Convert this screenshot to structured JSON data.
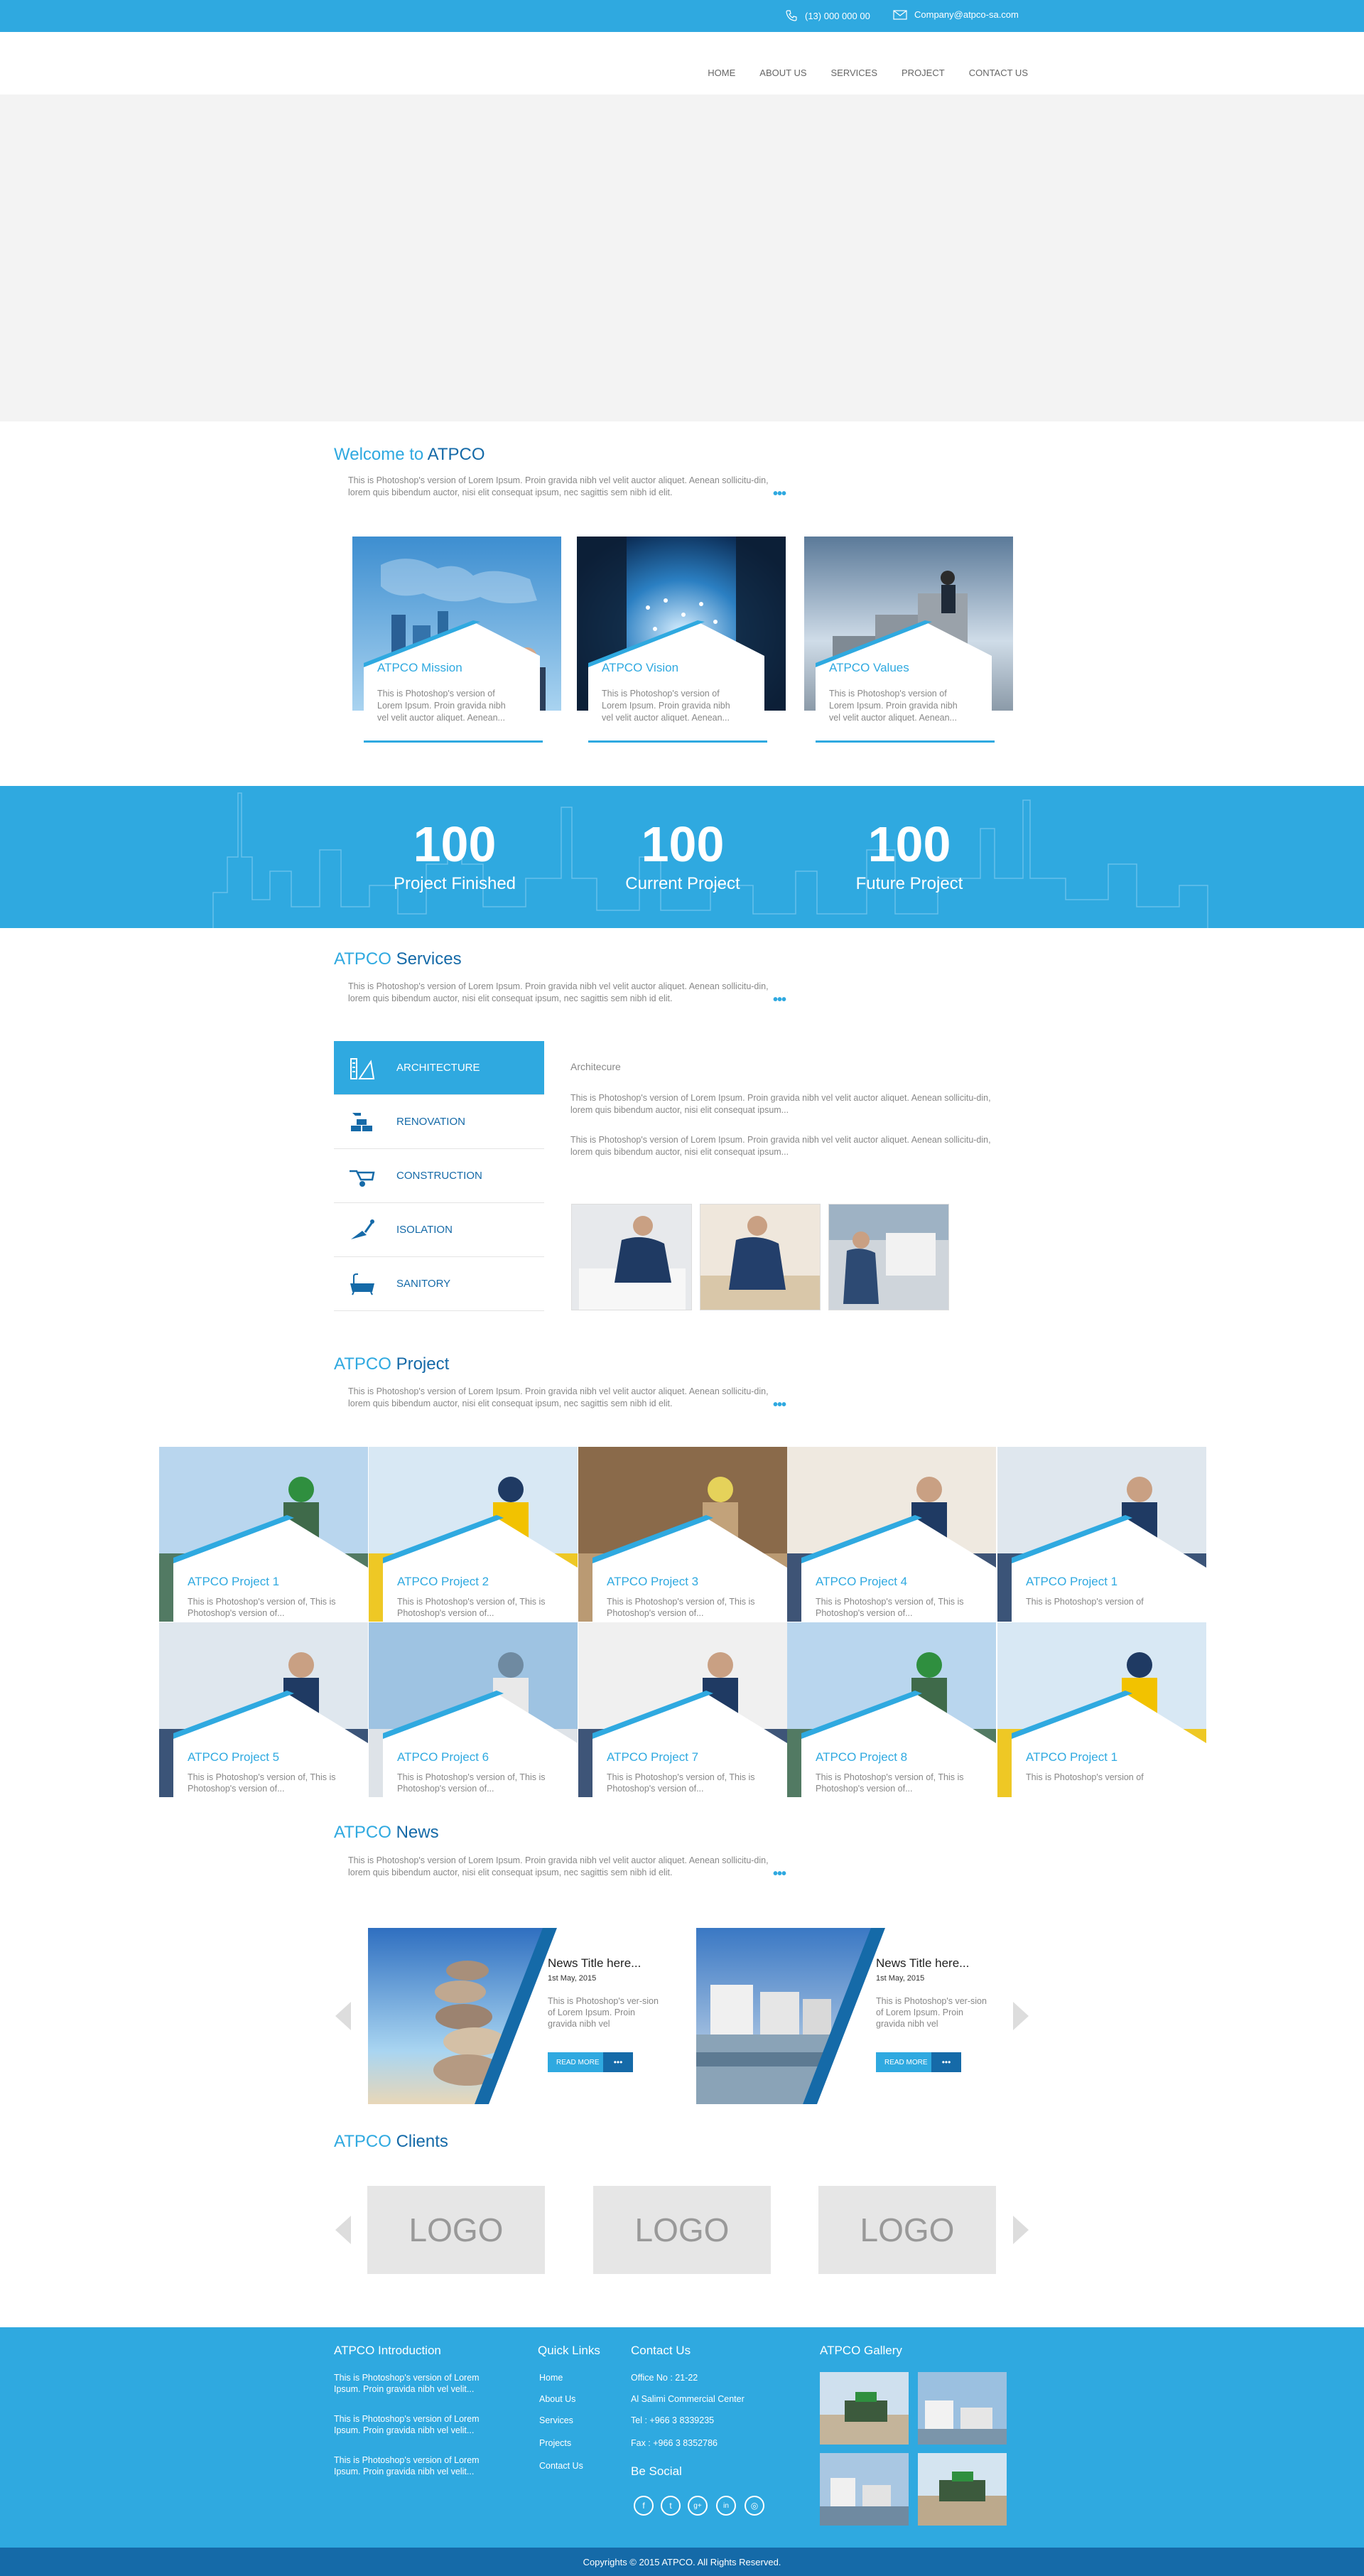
{
  "topbar": {
    "phone": "(13) 000 000 00",
    "email": "Company@atpco-sa.com"
  },
  "nav": [
    "HOME",
    "ABOUT US",
    "SERVICES",
    "PROJECT",
    "CONTACT US"
  ],
  "welcome": {
    "title_prefix": "Welcome to ",
    "title_brand": "ATPCO",
    "intro": "This is Photoshop's version  of Lorem Ipsum. Proin gravida nibh vel velit auctor aliquet. Aenean sollicitu-din, lorem quis bibendum auctor, nisi elit consequat ipsum, nec sagittis sem nibh id elit.",
    "more": "•••"
  },
  "cards": [
    {
      "title": "ATPCO Mission",
      "text": "This is Photoshop's version  of Lorem Ipsum. Proin gravida nibh vel velit auctor aliquet. Aenean..."
    },
    {
      "title": "ATPCO Vision",
      "text": "This is Photoshop's version  of Lorem Ipsum. Proin gravida nibh vel velit auctor aliquet. Aenean..."
    },
    {
      "title": "ATPCO Values",
      "text": "This is Photoshop's version  of Lorem Ipsum. Proin gravida nibh vel velit auctor aliquet. Aenean..."
    }
  ],
  "stats": [
    {
      "number": "100",
      "label": "Project Finished"
    },
    {
      "number": "100",
      "label": "Current Project"
    },
    {
      "number": "100",
      "label": "Future Project"
    }
  ],
  "services": {
    "title_prefix": "ATPCO ",
    "title_brand": "Services",
    "intro": "This is Photoshop's version  of Lorem Ipsum. Proin gravida nibh vel velit auctor aliquet. Aenean sollicitu-din, lorem quis bibendum auctor, nisi elit consequat ipsum, nec sagittis sem nibh id elit.",
    "more": "•••",
    "items": [
      {
        "label": "ARCHITECTURE",
        "icon": "architecture-icon"
      },
      {
        "label": "RENOVATION",
        "icon": "bricks-icon"
      },
      {
        "label": "CONSTRUCTION",
        "icon": "wheelbarrow-icon"
      },
      {
        "label": "ISOLATION",
        "icon": "trowel-icon"
      },
      {
        "label": "SANITORY",
        "icon": "bathtub-icon"
      }
    ],
    "detail_title": "Architecure",
    "detail_p1": "This is Photoshop's version  of Lorem Ipsum. Proin gravida nibh vel velit auctor aliquet. Aenean sollicitu-din, lorem quis bibendum auctor, nisi elit consequat ipsum...",
    "detail_p2": "This is Photoshop's version  of Lorem Ipsum. Proin gravida nibh vel velit auctor aliquet. Aenean sollicitu-din, lorem quis bibendum auctor, nisi elit consequat ipsum..."
  },
  "project": {
    "title_prefix": "ATPCO ",
    "title_brand": "Project",
    "intro": "This is Photoshop's version  of Lorem Ipsum. Proin gravida nibh vel velit auctor aliquet. Aenean sollicitu-din, lorem quis bibendum auctor, nisi elit consequat ipsum, nec sagittis sem nibh id elit.",
    "more": "•••",
    "items": [
      {
        "title": "ATPCO Project 1",
        "text": "This is Photoshop's version  of, This is Photoshop's version  of..."
      },
      {
        "title": "ATPCO Project 2",
        "text": "This is Photoshop's version  of, This is Photoshop's version  of..."
      },
      {
        "title": "ATPCO Project 3",
        "text": "This is Photoshop's version  of, This is Photoshop's version  of..."
      },
      {
        "title": "ATPCO Project 4",
        "text": "This is Photoshop's version  of, This is Photoshop's version  of..."
      },
      {
        "title": "ATPCO Project 1",
        "text": "This is Photoshop's version  of"
      },
      {
        "title": "ATPCO Project 5",
        "text": "This is Photoshop's version  of, This is Photoshop's version  of..."
      },
      {
        "title": "ATPCO Project 6",
        "text": "This is Photoshop's version  of, This is Photoshop's version  of..."
      },
      {
        "title": "ATPCO Project 7",
        "text": "This is Photoshop's version  of, This is Photoshop's version  of..."
      },
      {
        "title": "ATPCO Project 8",
        "text": "This is Photoshop's version  of, This is Photoshop's version  of..."
      },
      {
        "title": "ATPCO Project 1",
        "text": "This is Photoshop's version  of"
      }
    ]
  },
  "news": {
    "title_prefix": "ATPCO ",
    "title_brand": "News",
    "intro": "This is Photoshop's version  of Lorem Ipsum. Proin gravida nibh vel velit auctor aliquet. Aenean sollicitu-din, lorem quis bibendum auctor, nisi elit consequat ipsum, nec sagittis sem nibh id elit.",
    "more": "•••",
    "items": [
      {
        "title": "News Title here...",
        "date": "1st May, 2015",
        "text": "This is Photoshop's ver-sion  of Lorem Ipsum. Proin gravida nibh vel",
        "button": "READ MORE",
        "dots": "•••"
      },
      {
        "title": "News Title here...",
        "date": "1st May, 2015",
        "text": "This is Photoshop's ver-sion  of Lorem Ipsum. Proin gravida nibh vel",
        "button": "READ MORE",
        "dots": "•••"
      }
    ]
  },
  "clients": {
    "title_prefix": "ATPCO ",
    "title_brand": "Clients",
    "logos": [
      "LOGO",
      "LOGO",
      "LOGO"
    ]
  },
  "footer": {
    "intro_title": "ATPCO Introduction",
    "intro_paras": [
      "This is Photoshop's version  of Lorem Ipsum. Proin gravida nibh vel velit...",
      "This is Photoshop's version  of Lorem Ipsum. Proin gravida nibh vel velit...",
      "This is Photoshop's version  of Lorem Ipsum. Proin gravida nibh vel velit..."
    ],
    "links_title": "Quick Links",
    "links": [
      "Home",
      "About Us",
      "Services",
      "Projects",
      "Contact Us"
    ],
    "contact_title": "Contact Us",
    "contact_lines": [
      "Office No : 21-22",
      "Al Salimi Commercial Center",
      "Tel : +966 3 8339235",
      "Fax : +966 3 8352786"
    ],
    "social_title": "Be Social",
    "social": [
      "f",
      "t",
      "g+",
      "in",
      "◎"
    ],
    "gallery_title": "ATPCO Gallery",
    "copyright": "Copyrights © 2015 ATPCO. All Rights Reserved."
  },
  "colors": {
    "accent": "#2fa9e0",
    "dark_blue": "#156aa8"
  }
}
